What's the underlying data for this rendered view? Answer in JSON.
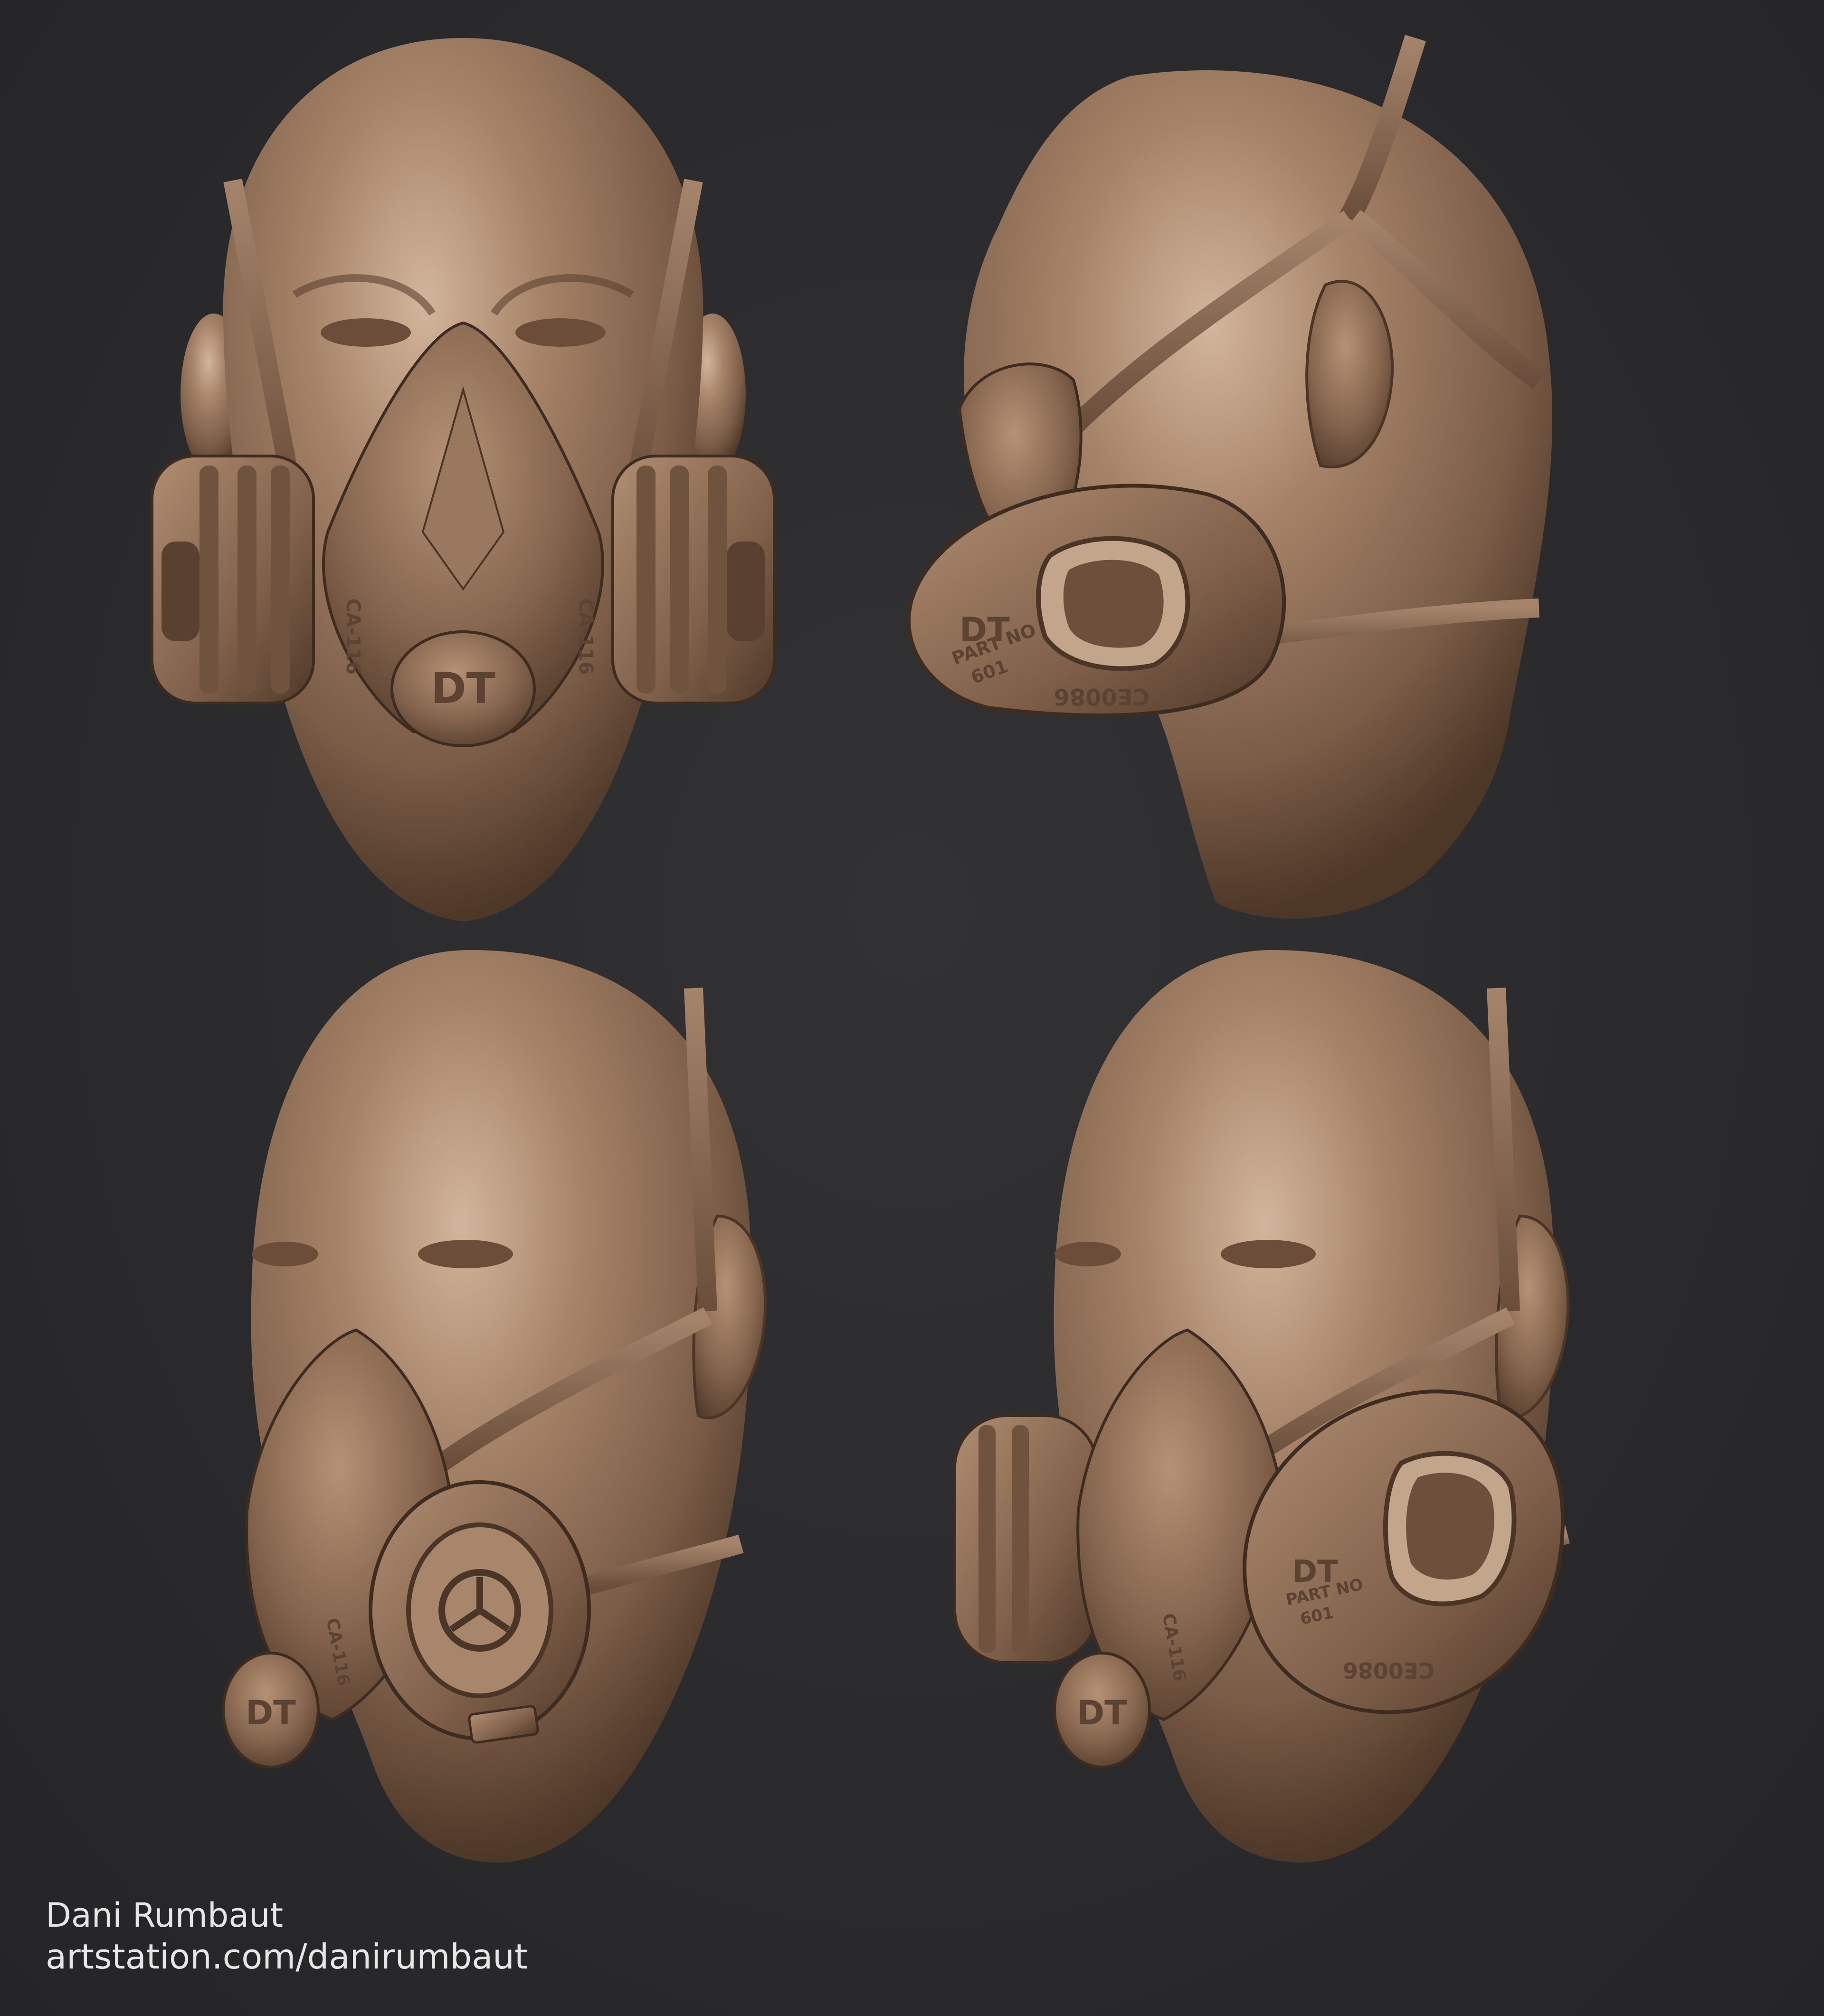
{
  "canvas": {
    "background": "#2b2b2d",
    "clay_color": "#8d6e58",
    "clay_highlight": "#c9ab92",
    "clay_shadow": "#4a3527"
  },
  "renders": [
    {
      "view": "front",
      "embossed_text": {
        "logo": "DT",
        "cartridge_code_left": "CA-116",
        "cartridge_code_right": "CA-116"
      }
    },
    {
      "view": "side-right",
      "embossed_text": {
        "logo": "DT",
        "part_label": "PART NO",
        "part_number": "601",
        "ce_mark": "CE0086"
      }
    },
    {
      "view": "three-quarter-no-filter",
      "embossed_text": {
        "logo": "DT",
        "cartridge_code": "CA-116"
      }
    },
    {
      "view": "three-quarter-with-filter",
      "embossed_text": {
        "logo": "DT",
        "cartridge_code": "CA-116",
        "part_label": "PART NO",
        "part_number": "601",
        "ce_mark": "CE0086"
      }
    }
  ],
  "credits": {
    "artist": "Dani Rumbaut",
    "url": "artstation.com/danirumbaut"
  }
}
